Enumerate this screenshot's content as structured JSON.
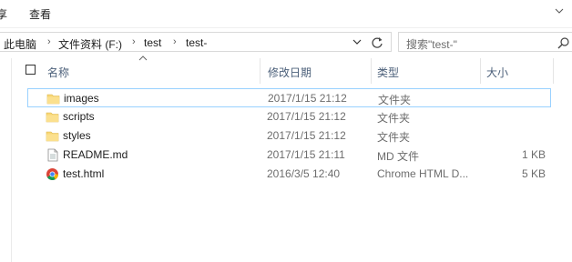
{
  "ribbon": {
    "tab_partial": "享",
    "tab_view": "查看"
  },
  "address": {
    "crumbs": [
      "此电脑",
      "文件资料 (F:)",
      "test",
      "test-"
    ],
    "separator": "›"
  },
  "search": {
    "placeholder": "搜索\"test-\""
  },
  "columns": {
    "name": "名称",
    "modified": "修改日期",
    "type": "类型",
    "size": "大小"
  },
  "files": [
    {
      "name": "images",
      "modified": "2017/1/15 21:12",
      "type": "文件夹",
      "size": "",
      "icon": "folder-icon",
      "selected": true
    },
    {
      "name": "scripts",
      "modified": "2017/1/15 21:12",
      "type": "文件夹",
      "size": "",
      "icon": "folder-icon",
      "selected": false
    },
    {
      "name": "styles",
      "modified": "2017/1/15 21:12",
      "type": "文件夹",
      "size": "",
      "icon": "folder-icon",
      "selected": false
    },
    {
      "name": "README.md",
      "modified": "2017/1/15 21:11",
      "type": "MD 文件",
      "size": "1 KB",
      "icon": "text-file-icon",
      "selected": false
    },
    {
      "name": "test.html",
      "modified": "2016/3/5 12:40",
      "type": "Chrome HTML D...",
      "size": "5 KB",
      "icon": "chrome-icon",
      "selected": false
    }
  ],
  "colors": {
    "selection_border": "#99d1ff",
    "folder": "#f8d775",
    "header_text": "#4c607a"
  }
}
